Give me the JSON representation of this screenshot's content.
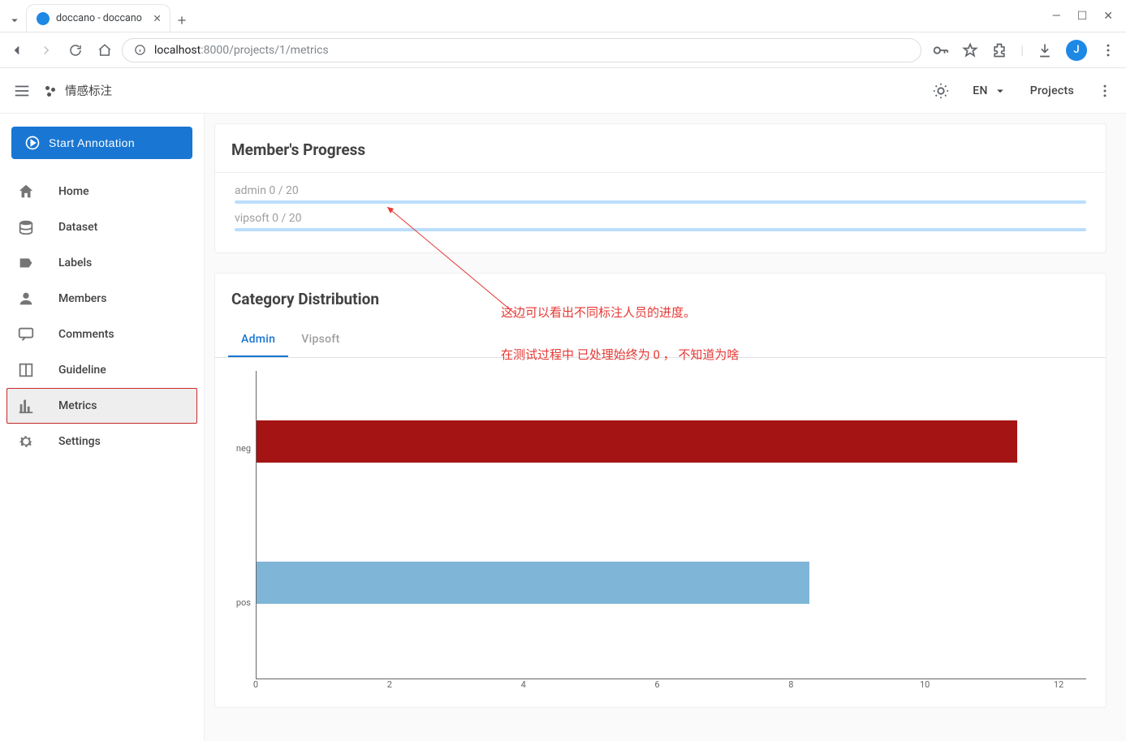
{
  "browser": {
    "tab_title": "doccano - doccano",
    "url_host": "localhost",
    "url_port": ":8000",
    "url_path": "/projects/1/metrics",
    "avatar_letter": "J"
  },
  "header": {
    "project_name": "情感标注",
    "language": "EN",
    "projects_link": "Projects"
  },
  "sidebar": {
    "start_button": "Start Annotation",
    "items": [
      {
        "label": "Home",
        "icon": "home-icon"
      },
      {
        "label": "Dataset",
        "icon": "database-icon"
      },
      {
        "label": "Labels",
        "icon": "label-icon"
      },
      {
        "label": "Members",
        "icon": "person-icon"
      },
      {
        "label": "Comments",
        "icon": "comment-icon"
      },
      {
        "label": "Guideline",
        "icon": "book-icon"
      },
      {
        "label": "Metrics",
        "icon": "chart-icon"
      },
      {
        "label": "Settings",
        "icon": "gear-icon"
      }
    ],
    "active_index": 6
  },
  "cards": {
    "progress": {
      "title": "Member's Progress",
      "members": [
        {
          "name": "admin",
          "done": 0,
          "total": 20,
          "text": "admin 0 / 20"
        },
        {
          "name": "vipsoft",
          "done": 0,
          "total": 20,
          "text": "vipsoft 0 / 20"
        }
      ]
    },
    "distribution": {
      "title": "Category Distribution",
      "tabs": [
        {
          "label": "Admin",
          "active": true
        },
        {
          "label": "Vipsoft",
          "active": false
        }
      ]
    }
  },
  "annotations": {
    "line1": "这边可以看出不同标注人员的进度。",
    "line2": "在测试过程中 已处理始终为 0 ， 不知道为啥"
  },
  "chart_data": {
    "type": "bar",
    "orientation": "horizontal",
    "categories": [
      "neg",
      "pos"
    ],
    "values": [
      11,
      8
    ],
    "colors": [
      "#a51414",
      "#7fb5d7"
    ],
    "xlim": [
      0,
      12
    ],
    "xticks": [
      0,
      2,
      4,
      6,
      8,
      10,
      12
    ]
  }
}
